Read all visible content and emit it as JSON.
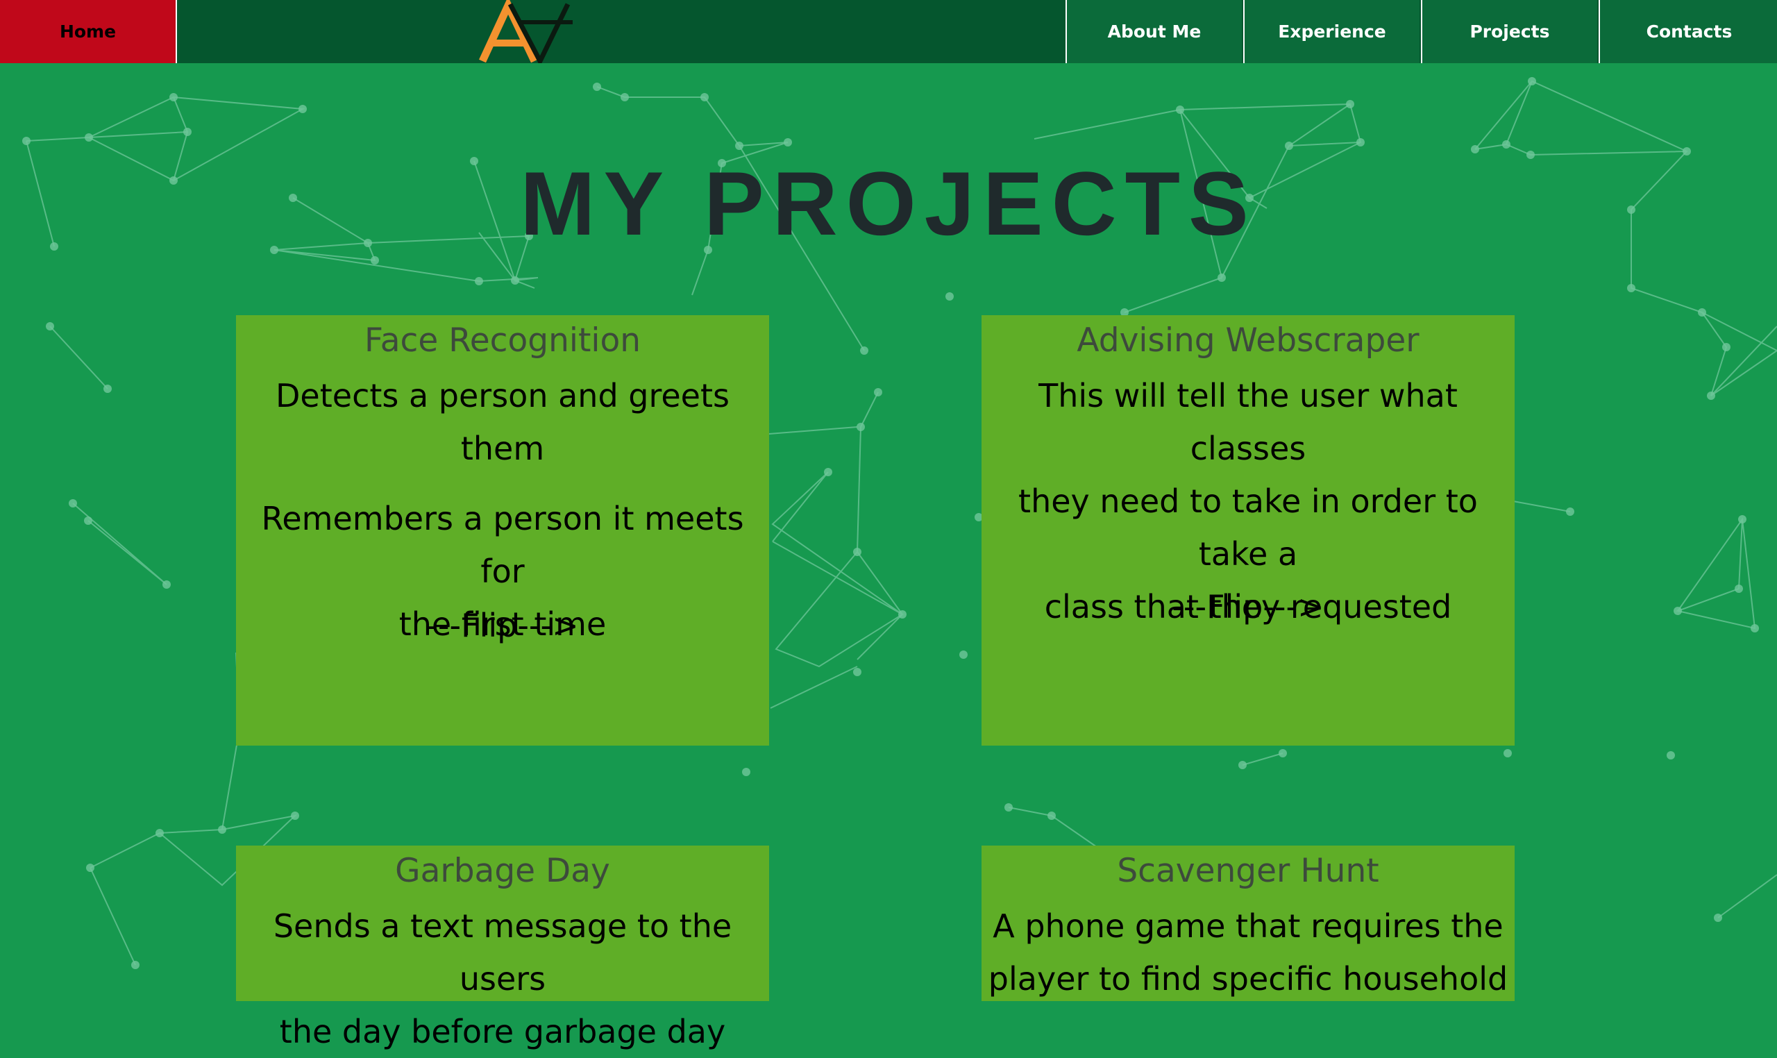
{
  "nav": {
    "home": "Home",
    "logo_text": "AA",
    "items": [
      "About Me",
      "Experience",
      "Projects",
      "Contacts"
    ]
  },
  "page_title": "MY PROJECTS",
  "cards": [
    {
      "title": "Face Recognition",
      "lines": [
        "Detects a person and greets them",
        "Remembers a person it meets for",
        "the first time"
      ],
      "flip": "---Flip--->"
    },
    {
      "title": "Advising Webscraper",
      "lines": [
        "This will tell the user what classes",
        "they need to take in order to take a",
        "class that they requested"
      ],
      "flip": "---Flip--->"
    },
    {
      "title": "Garbage Day",
      "lines": [
        "Sends a text message to the users",
        "the day before garbage day"
      ]
    },
    {
      "title": "Scavenger Hunt",
      "lines": [
        "A phone game that requires the",
        "player to find specific household"
      ]
    }
  ],
  "colors": {
    "background": "#16994f",
    "navbar": "#05562e",
    "home_tab": "#c0081a",
    "card": "#5fae27",
    "logo_orange": "#f4922f"
  }
}
